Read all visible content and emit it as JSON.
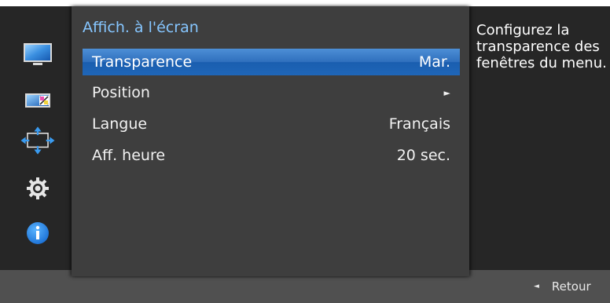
{
  "left_rail": {
    "items": [
      {
        "icon": "monitor-picture-icon"
      },
      {
        "icon": "color-balance-icon"
      },
      {
        "icon": "onscreen-display-icon",
        "active": true
      },
      {
        "icon": "gear-icon"
      },
      {
        "icon": "info-icon"
      }
    ]
  },
  "main_panel": {
    "title": "Affich. à l'écran",
    "items": [
      {
        "label": "Transparence",
        "value": "Mar.",
        "selected": true
      },
      {
        "label": "Position",
        "value": "►"
      },
      {
        "label": "Langue",
        "value": "Français"
      },
      {
        "label": "Aff. heure",
        "value": "20 sec."
      }
    ]
  },
  "help_panel": {
    "text": "Configurez la transparence des fenêtres du menu."
  },
  "bottom_bar": {
    "back_arrow": "◄",
    "back_label": "Retour"
  },
  "colors": {
    "title_blue": "#86c6ff",
    "highlight_blue": "#1f66b8",
    "panel_bg": "#3e3e3e",
    "rail_bg": "#262626",
    "bottom_bg": "#505050"
  }
}
